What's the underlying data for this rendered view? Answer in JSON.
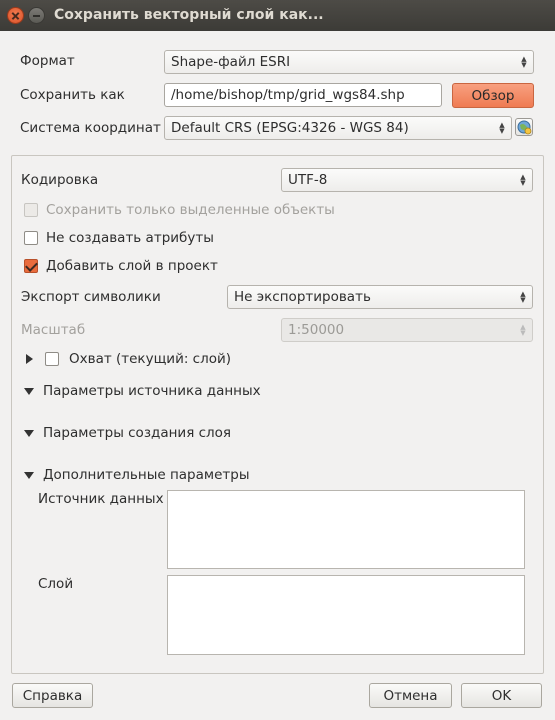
{
  "window": {
    "title": "Сохранить векторный слой как..."
  },
  "format": {
    "label": "Формат",
    "value": "Shape-файл ESRI"
  },
  "save_as": {
    "label": "Сохранить как",
    "value": "/home/bishop/tmp/grid_wgs84.shp",
    "browse_label": "Обзор"
  },
  "crs": {
    "label": "Система координат",
    "value": "Default CRS (EPSG:4326 - WGS 84)"
  },
  "encoding": {
    "label": "Кодировка",
    "value": "UTF-8"
  },
  "options": {
    "selected_only": {
      "label": "Сохранить только выделенные объекты",
      "checked": false,
      "enabled": false
    },
    "no_attributes": {
      "label": "Не создавать атрибуты",
      "checked": false
    },
    "add_to_project": {
      "label": "Добавить слой в проект",
      "checked": true
    }
  },
  "symbology": {
    "label": "Экспорт символики",
    "value": "Не экспортировать"
  },
  "scale": {
    "label": "Масштаб",
    "value": "1:50000"
  },
  "sections": {
    "extent": "Охват (текущий: слой)",
    "datasource_options": "Параметры источника данных",
    "layer_options": "Параметры создания слоя",
    "custom_options": "Дополнительные параметры",
    "datasource_label": "Источник данных",
    "layer_label": "Слой"
  },
  "footer": {
    "help": "Справка",
    "cancel": "Отмена",
    "ok": "OK"
  },
  "colors": {
    "accent": "#e96c3d",
    "titlebar": "#3c3b37",
    "background": "#f2f1f0"
  }
}
